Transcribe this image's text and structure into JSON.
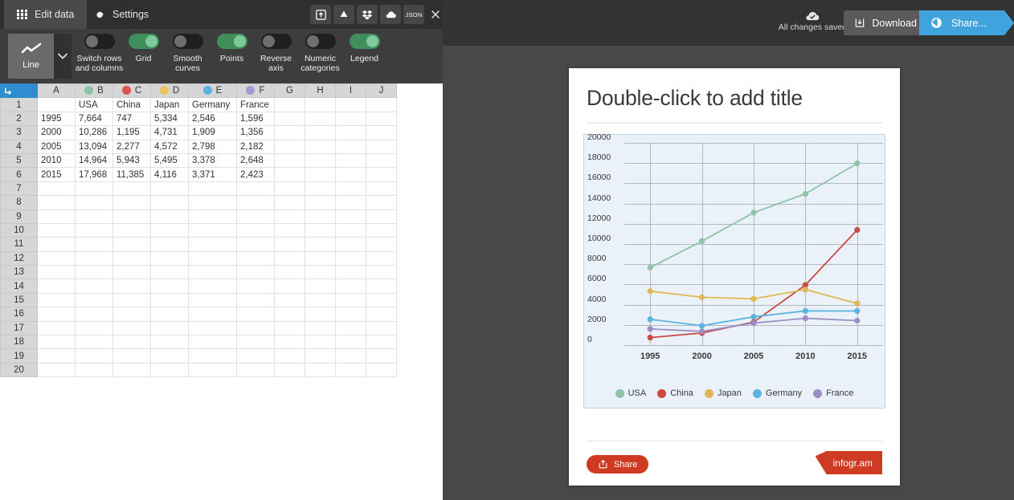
{
  "editor": {
    "tabs": [
      {
        "label": "Edit data",
        "icon": "grid-dots-icon",
        "active": true
      },
      {
        "label": "Settings",
        "icon": "gear-icon",
        "active": false
      }
    ],
    "top_icons": [
      {
        "name": "upload-icon"
      },
      {
        "name": "google-drive-icon"
      },
      {
        "name": "dropbox-icon"
      },
      {
        "name": "onedrive-icon"
      },
      {
        "name": "json-icon",
        "label": "JSON"
      },
      {
        "name": "close-icon"
      }
    ],
    "chart_type": {
      "label": "Line",
      "icon": "line-chart-icon",
      "caret": "chevron-down-icon"
    },
    "toggles": [
      {
        "label": "Switch rows and columns",
        "on": false
      },
      {
        "label": "Grid",
        "on": true
      },
      {
        "label": "Smooth curves",
        "on": false
      },
      {
        "label": "Points",
        "on": true
      },
      {
        "label": "Reverse axis",
        "on": false
      },
      {
        "label": "Numeric categories",
        "on": false
      },
      {
        "label": "Legend",
        "on": true
      }
    ]
  },
  "sheet": {
    "corner_icon": "select-all-icon",
    "columns": [
      {
        "letter": "A",
        "color": null
      },
      {
        "letter": "B",
        "color": "#8dc3a7"
      },
      {
        "letter": "C",
        "color": "#d9534f"
      },
      {
        "letter": "D",
        "color": "#e8c35c"
      },
      {
        "letter": "E",
        "color": "#5bb3e0"
      },
      {
        "letter": "F",
        "color": "#a898d2"
      },
      {
        "letter": "G",
        "color": null
      },
      {
        "letter": "H",
        "color": null
      },
      {
        "letter": "I",
        "color": null
      },
      {
        "letter": "J",
        "color": null
      }
    ],
    "header_row": [
      "",
      "USA",
      "China",
      "Japan",
      "Germany",
      "France",
      "",
      "",
      "",
      ""
    ],
    "rows": [
      [
        "1995",
        "7,664",
        "747",
        "5,334",
        "2,546",
        "1,596",
        "",
        "",
        "",
        ""
      ],
      [
        "2000",
        "10,286",
        "1,195",
        "4,731",
        "1,909",
        "1,356",
        "",
        "",
        "",
        ""
      ],
      [
        "2005",
        "13,094",
        "2,277",
        "4,572",
        "2,798",
        "2,182",
        "",
        "",
        "",
        ""
      ],
      [
        "2010",
        "14,964",
        "5,943",
        "5,495",
        "3,378",
        "2,648",
        "",
        "",
        "",
        ""
      ],
      [
        "2015",
        "17,968",
        "11,385",
        "4,116",
        "3,371",
        "2,423",
        "",
        "",
        "",
        ""
      ]
    ],
    "total_rows": 20
  },
  "workspace": {
    "save_status": "All changes saved",
    "save_icon": "cloud-check-icon",
    "download_label": "Download",
    "download_icon": "download-icon",
    "share_label": "Share...",
    "share_icon": "share-globe-icon"
  },
  "card": {
    "title": "Double-click to add title",
    "share_label": "Share",
    "share_icon": "share-arrow-icon",
    "badge_label": "infogr.am"
  },
  "chart_data": {
    "type": "line",
    "title": "",
    "xlabel": "",
    "ylabel": "",
    "x": [
      "1995",
      "2000",
      "2005",
      "2010",
      "2015"
    ],
    "categories": [
      "1995",
      "2000",
      "2005",
      "2010",
      "2015"
    ],
    "yticks": [
      0,
      2000,
      4000,
      6000,
      8000,
      10000,
      12000,
      14000,
      16000,
      18000,
      20000
    ],
    "ylim": [
      0,
      20000
    ],
    "grid": true,
    "points": true,
    "smooth": false,
    "legend": true,
    "legend_position": "bottom",
    "series": [
      {
        "name": "USA",
        "color": "#8dc3a7",
        "values": [
          7664,
          10286,
          13094,
          14964,
          17968
        ]
      },
      {
        "name": "China",
        "color": "#c94a43",
        "values": [
          747,
          1195,
          2277,
          5943,
          11385
        ]
      },
      {
        "name": "Japan",
        "color": "#e0b853",
        "values": [
          5334,
          4731,
          4572,
          5495,
          4116
        ]
      },
      {
        "name": "Germany",
        "color": "#5bb3e0",
        "values": [
          2546,
          1909,
          2798,
          3378,
          3371
        ]
      },
      {
        "name": "France",
        "color": "#9b8ec4",
        "values": [
          1596,
          1356,
          2182,
          2648,
          2423
        ]
      }
    ]
  },
  "colors": {
    "accent_blue": "#41a3dd",
    "accent_red": "#cf3a22",
    "toggle_on": "#3f8f5d",
    "plot_bg": "#eaf1f9"
  }
}
